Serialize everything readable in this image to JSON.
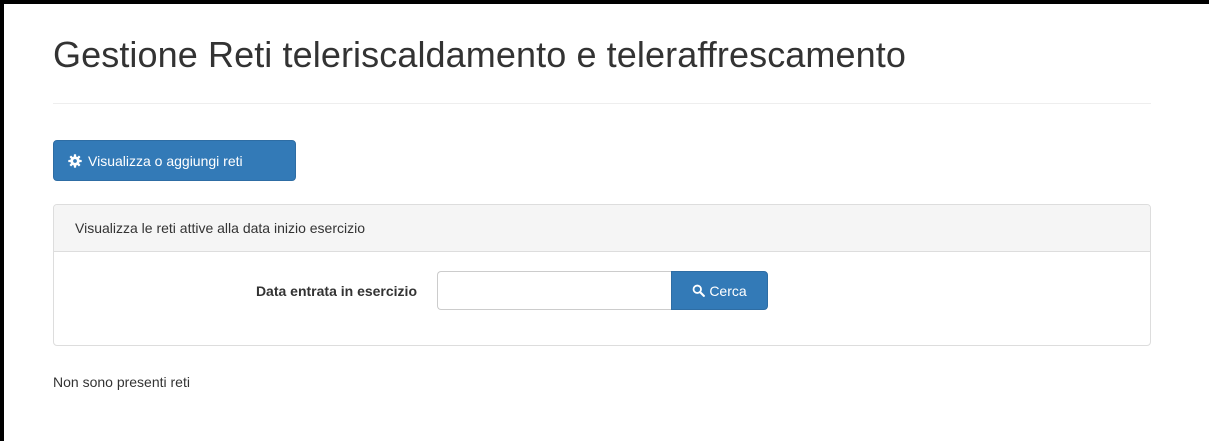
{
  "page": {
    "title": "Gestione Reti teleriscaldamento e teleraffrescamento"
  },
  "toolbar": {
    "manage_button_label": "Visualizza o aggiungi reti",
    "manage_button_icon": "gear-icon"
  },
  "filter_panel": {
    "heading": "Visualizza le reti attive alla data inizio esercizio",
    "date_label": "Data entrata in esercizio",
    "date_value": "",
    "date_placeholder": "",
    "search_button_label": "Cerca",
    "search_button_icon": "search-icon"
  },
  "results": {
    "empty_message": "Non sono presenti reti"
  },
  "colors": {
    "primary": "#337ab7",
    "primary_border": "#2e6da4",
    "panel_heading_bg": "#f5f5f5",
    "panel_border": "#dddddd",
    "text": "#333333"
  }
}
